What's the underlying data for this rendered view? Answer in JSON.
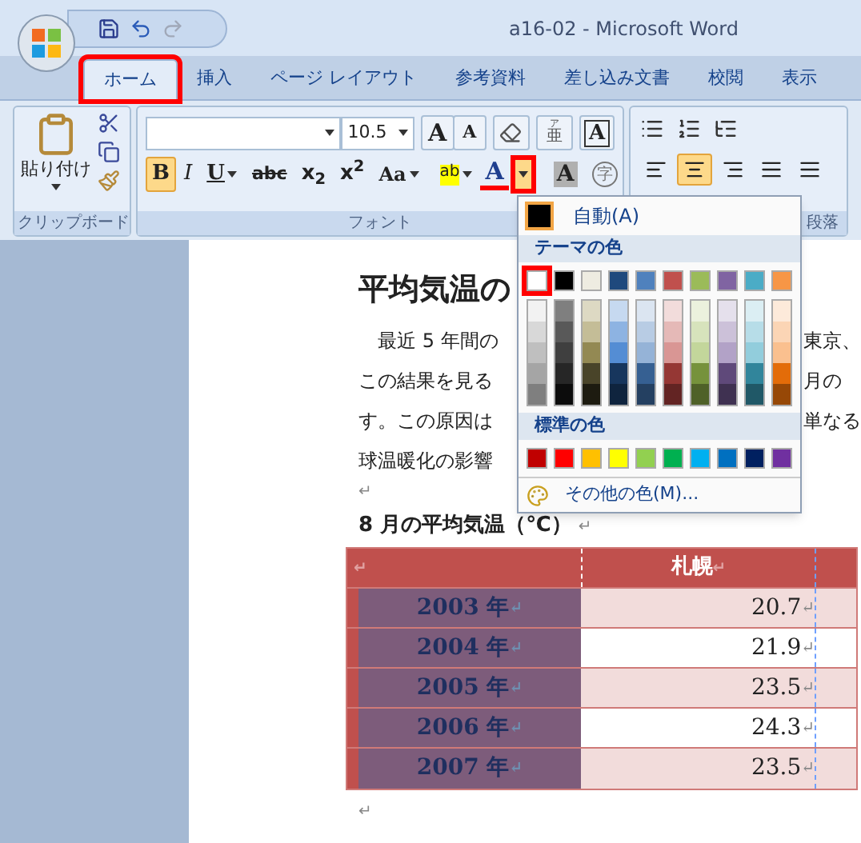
{
  "window": {
    "title": "a16-02 - Microsoft Word"
  },
  "tabs": [
    {
      "label": "ホーム",
      "selected": true,
      "highlighted": true
    },
    {
      "label": "挿入",
      "selected": false,
      "highlighted": false
    },
    {
      "label": "ページ レイアウト",
      "selected": false,
      "highlighted": false
    },
    {
      "label": "参考資料",
      "selected": false,
      "highlighted": false
    },
    {
      "label": "差し込み文書",
      "selected": false,
      "highlighted": false
    },
    {
      "label": "校閲",
      "selected": false,
      "highlighted": false
    },
    {
      "label": "表示",
      "selected": false,
      "highlighted": false
    }
  ],
  "clipboard": {
    "label": "クリップボード",
    "paste": "貼り付け"
  },
  "font_group": {
    "label": "フォント",
    "size": "10.5",
    "row1": [
      {
        "kind": "grow",
        "label": "A"
      },
      {
        "kind": "shrink",
        "label": "A"
      },
      {
        "kind": "clear"
      },
      {
        "kind": "phonetic",
        "label": "亜",
        "ruby": "ア"
      },
      {
        "kind": "border",
        "label": "A"
      }
    ],
    "row2": [
      {
        "kind": "bold",
        "label": "B",
        "selected": true
      },
      {
        "kind": "italic",
        "label": "I",
        "selected": false
      },
      {
        "kind": "underline",
        "label": "U",
        "selected": false
      },
      {
        "kind": "strike",
        "label": "abc",
        "selected": false
      },
      {
        "kind": "sub",
        "label": "x$_{2}$",
        "selected": false
      },
      {
        "kind": "sup",
        "label": "x$^{2}$",
        "selected": false
      },
      {
        "kind": "case",
        "label": "Aa",
        "selected": false
      },
      {
        "kind": "highlight",
        "label": "ab",
        "selected": false
      },
      {
        "kind": "fontcolor",
        "label": "A",
        "selected": true,
        "highlighted": true
      },
      {
        "kind": "shade",
        "label": "A",
        "selected": false
      },
      {
        "kind": "enclose",
        "label": "字",
        "selected": false
      }
    ]
  },
  "paragraph_group": {
    "label": "段落",
    "align": [
      {
        "kind": "left",
        "selected": false
      },
      {
        "kind": "center",
        "selected": true
      },
      {
        "kind": "right",
        "selected": false
      },
      {
        "kind": "justify",
        "selected": false
      },
      {
        "kind": "distribute",
        "selected": false
      }
    ]
  },
  "color_menu": {
    "auto": "自動(A)",
    "theme_header": "テーマの色",
    "standard_header": "標準の色",
    "more": "その他の色(M)...",
    "theme": [
      {
        "color": "#ffffff",
        "highlighted": true,
        "shades": [
          {
            "color": "#f2f2f2"
          },
          {
            "color": "#d8d8d8"
          },
          {
            "color": "#bfbfbf"
          },
          {
            "color": "#a5a5a5"
          },
          {
            "color": "#7f7f7f"
          }
        ]
      },
      {
        "color": "#000000",
        "highlighted": false,
        "shades": [
          {
            "color": "#7f7f7f"
          },
          {
            "color": "#595959"
          },
          {
            "color": "#3f3f3f"
          },
          {
            "color": "#262626"
          },
          {
            "color": "#0c0c0c"
          }
        ]
      },
      {
        "color": "#eeece1",
        "highlighted": false,
        "shades": [
          {
            "color": "#ddd9c3"
          },
          {
            "color": "#c4bd97"
          },
          {
            "color": "#938953"
          },
          {
            "color": "#494429"
          },
          {
            "color": "#1d1b10"
          }
        ]
      },
      {
        "color": "#1f497d",
        "highlighted": false,
        "shades": [
          {
            "color": "#c6d9f0"
          },
          {
            "color": "#8db3e2"
          },
          {
            "color": "#548dd4"
          },
          {
            "color": "#17365d"
          },
          {
            "color": "#0f243e"
          }
        ]
      },
      {
        "color": "#4f81bd",
        "highlighted": false,
        "shades": [
          {
            "color": "#dbe5f1"
          },
          {
            "color": "#b8cce4"
          },
          {
            "color": "#95b3d7"
          },
          {
            "color": "#366092"
          },
          {
            "color": "#244061"
          }
        ]
      },
      {
        "color": "#c0504d",
        "highlighted": false,
        "shades": [
          {
            "color": "#f2dcdb"
          },
          {
            "color": "#e5b9b7"
          },
          {
            "color": "#d99694"
          },
          {
            "color": "#953734"
          },
          {
            "color": "#632423"
          }
        ]
      },
      {
        "color": "#9bbb59",
        "highlighted": false,
        "shades": [
          {
            "color": "#ebf1dd"
          },
          {
            "color": "#d7e3bc"
          },
          {
            "color": "#c3d69b"
          },
          {
            "color": "#76923c"
          },
          {
            "color": "#4f6128"
          }
        ]
      },
      {
        "color": "#8064a2",
        "highlighted": false,
        "shades": [
          {
            "color": "#e5e0ec"
          },
          {
            "color": "#ccc1d9"
          },
          {
            "color": "#b2a2c7"
          },
          {
            "color": "#5f497a"
          },
          {
            "color": "#3f3151"
          }
        ]
      },
      {
        "color": "#4bacc6",
        "highlighted": false,
        "shades": [
          {
            "color": "#dbeef3"
          },
          {
            "color": "#b7dde8"
          },
          {
            "color": "#92cddc"
          },
          {
            "color": "#31859b"
          },
          {
            "color": "#205867"
          }
        ]
      },
      {
        "color": "#f79646",
        "highlighted": false,
        "shades": [
          {
            "color": "#fdeada"
          },
          {
            "color": "#fbd5b5"
          },
          {
            "color": "#fac08f"
          },
          {
            "color": "#e36c09"
          },
          {
            "color": "#974806"
          }
        ]
      }
    ],
    "standard": [
      {
        "color": "#c00000"
      },
      {
        "color": "#ff0000"
      },
      {
        "color": "#ffc000"
      },
      {
        "color": "#ffff00"
      },
      {
        "color": "#92d050"
      },
      {
        "color": "#00b050"
      },
      {
        "color": "#00b0f0"
      },
      {
        "color": "#0070c0"
      },
      {
        "color": "#002060"
      },
      {
        "color": "#7030a0"
      }
    ]
  },
  "document": {
    "title": "平均気温の",
    "lines": [
      {
        "left": "　最近 5 年間の",
        "right": "東京、"
      },
      {
        "left": "この結果を見る",
        "right": "月の"
      },
      {
        "left": "す。この原因は",
        "right": "単なる"
      },
      {
        "left": "球温暖化の影響"
      }
    ],
    "empty_mark": "↵",
    "caption": "8 月の平均気温（℃）",
    "caption_mark": "↵",
    "table": {
      "columns": [
        {
          "mark": "↵"
        },
        {
          "text": "札幌",
          "mark": "↵"
        }
      ],
      "rows": [
        {
          "year": "2003 年",
          "mark": "↵",
          "value": "20.7",
          "value_mark": "↵",
          "shaded": true
        },
        {
          "year": "2004 年",
          "mark": "↵",
          "value": "21.9",
          "value_mark": "↵",
          "shaded": false
        },
        {
          "year": "2005 年",
          "mark": "↵",
          "value": "23.5",
          "value_mark": "↵",
          "shaded": true
        },
        {
          "year": "2006 年",
          "mark": "↵",
          "value": "24.3",
          "value_mark": "↵",
          "shaded": false
        },
        {
          "year": "2007 年",
          "mark": "↵",
          "value": "23.5",
          "value_mark": "↵",
          "shaded": true
        }
      ]
    },
    "end_mark": "↵"
  }
}
